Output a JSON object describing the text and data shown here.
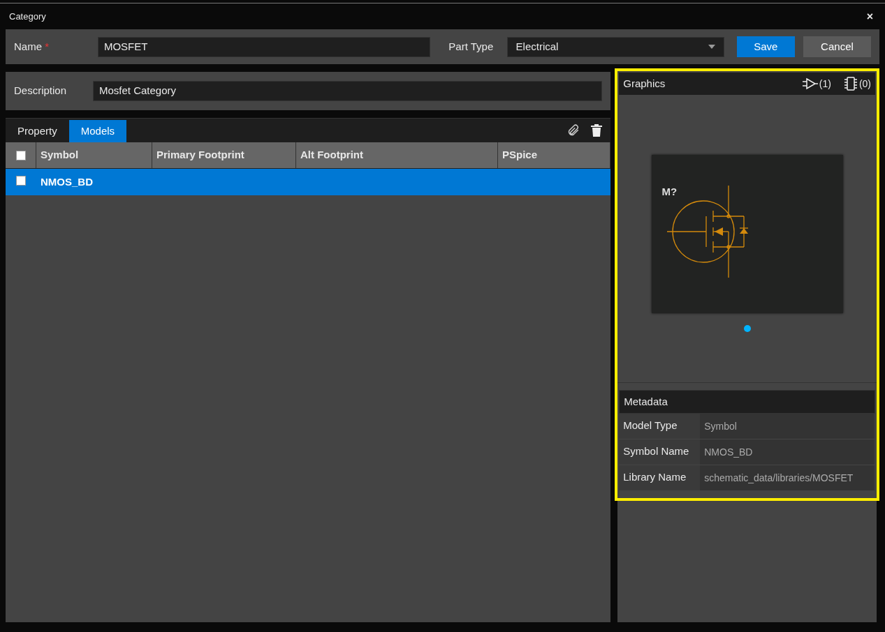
{
  "window": {
    "title": "Category",
    "close": "×"
  },
  "name_field": {
    "label": "Name",
    "required": "*",
    "value": "MOSFET"
  },
  "part_type": {
    "label": "Part Type",
    "value": "Electrical"
  },
  "buttons": [
    {
      "label": "Save",
      "kind": "primary"
    },
    {
      "label": "Cancel",
      "kind": "secondary"
    }
  ],
  "description": {
    "label": "Description",
    "value": "Mosfet Category"
  },
  "tabs": [
    {
      "label": "Property",
      "selected": false
    },
    {
      "label": "Models",
      "selected": true
    }
  ],
  "table": {
    "select_all_checked": false,
    "columns": [
      "Symbol",
      "Primary Footprint",
      "Alt Footprint",
      "PSpice"
    ],
    "rows": [
      {
        "symbol": "NMOS_BD",
        "selected": true,
        "checked": false
      }
    ]
  },
  "graphics": {
    "title": "Graphics",
    "symbol_count": "(1)",
    "footprint_count": "(0)",
    "preview_label": "M?",
    "pages": [
      {
        "selected": true
      }
    ]
  },
  "metadata": {
    "title": "Metadata",
    "rows": [
      {
        "label": "Model Type",
        "value": "Symbol"
      },
      {
        "label": "Symbol Name",
        "value": "NMOS_BD"
      },
      {
        "label": "Library Name",
        "value": "schematic_data/libraries/MOSFET"
      }
    ]
  }
}
